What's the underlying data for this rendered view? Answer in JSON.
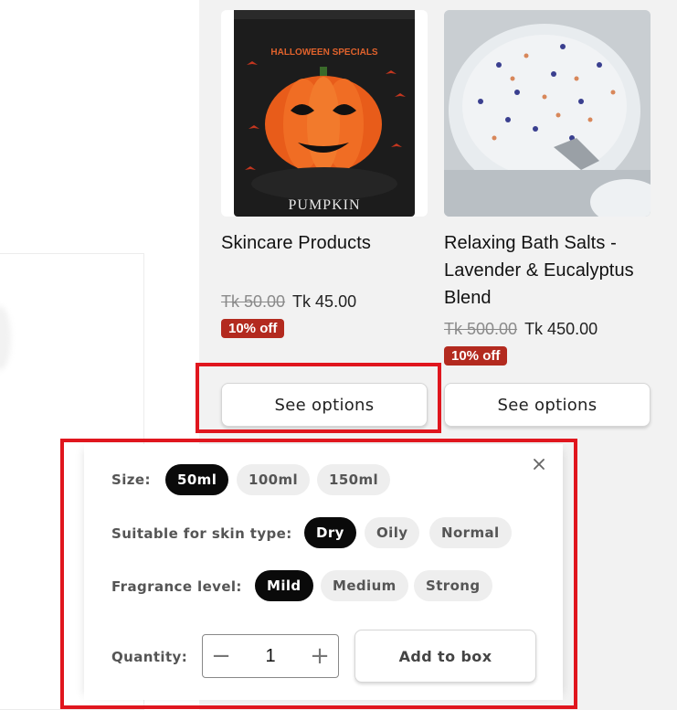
{
  "products": [
    {
      "image_text_top": "HALLOWEEN SPECIALS",
      "image_text_bottom": "PUMPKIN",
      "title": "Skincare Products",
      "price_old": "Tk 50.00",
      "price_new": "Tk 45.00",
      "badge": "10% off",
      "button": "See options"
    },
    {
      "title_line1": "Relaxing Bath Salts -",
      "title_line2": "Lavender & Eucalyptus",
      "title_line3": "Blend",
      "price_old": "Tk 500.00",
      "price_new": "Tk 450.00",
      "badge": "10% off",
      "button": "See options"
    }
  ],
  "options_panel": {
    "close_icon": "close-icon",
    "size": {
      "label": "Size:",
      "options": [
        "50ml",
        "100ml",
        "150ml"
      ],
      "selected": "50ml"
    },
    "skin_type": {
      "label": "Suitable for skin type:",
      "options": [
        "Dry",
        "Oily",
        "Normal"
      ],
      "selected": "Dry"
    },
    "fragrance": {
      "label": "Fragrance level:",
      "options": [
        "Mild",
        "Medium",
        "Strong"
      ],
      "selected": "Mild"
    },
    "quantity": {
      "label": "Quantity:",
      "value": "1",
      "minus": "−",
      "plus": "+"
    },
    "add_button": "Add to box"
  },
  "colors": {
    "badge": "#b32a1f",
    "highlight": "#e0161e",
    "chip_selected": "#0a0a0a",
    "chip": "#eeeeee"
  }
}
